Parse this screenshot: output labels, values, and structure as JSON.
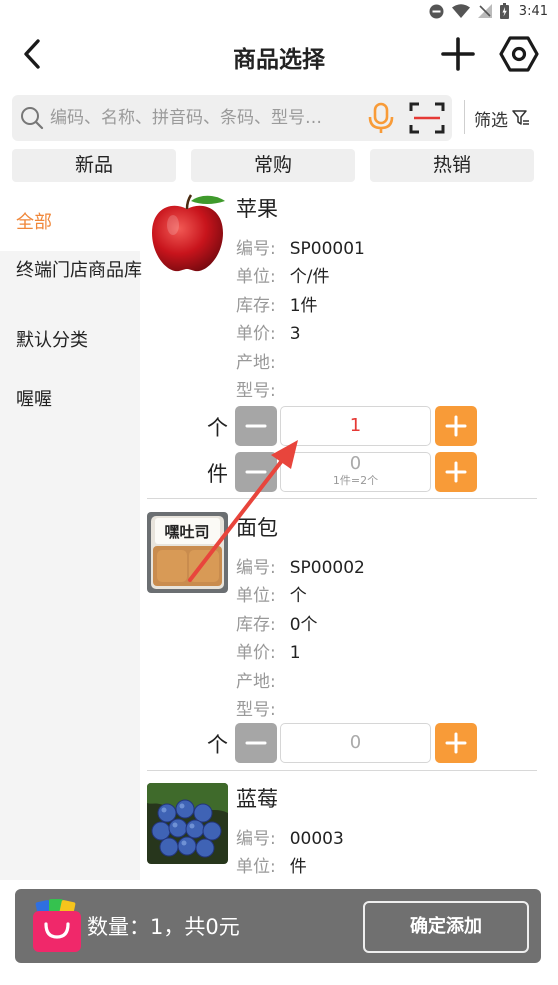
{
  "status": {
    "time": "3:41"
  },
  "header": {
    "title": "商品选择"
  },
  "search": {
    "placeholder": "编码、名称、拼音码、条码、型号…",
    "filter_label": "筛选"
  },
  "tabs": [
    {
      "label": "新品"
    },
    {
      "label": "常购"
    },
    {
      "label": "热销"
    }
  ],
  "sidebar": {
    "items": [
      {
        "label": "全部",
        "active": true
      },
      {
        "label": "终端门店商品库"
      },
      {
        "label": "默认分类"
      },
      {
        "label": "喔喔"
      }
    ]
  },
  "labels": {
    "code": "编号:",
    "unit": "单位:",
    "stock": "库存:",
    "price": "单价:",
    "origin": "产地:",
    "model": "型号:"
  },
  "products": [
    {
      "name": "苹果",
      "image": "apple",
      "code": "SP00001",
      "unit": "个/件",
      "stock": "1件",
      "price": "3",
      "origin": "",
      "model": "",
      "qty_rows": [
        {
          "unit": "个",
          "value": "1",
          "hint": ""
        },
        {
          "unit": "件",
          "value": "0",
          "hint": "1件=2个"
        }
      ]
    },
    {
      "name": "面包",
      "image": "bread",
      "image_text": "嘿吐司",
      "code": "SP00002",
      "unit": "个",
      "stock": "0个",
      "price": "1",
      "origin": "",
      "model": "",
      "qty_rows": [
        {
          "unit": "个",
          "value": "0",
          "hint": ""
        }
      ]
    },
    {
      "name": "蓝莓",
      "image": "blueberry",
      "code": "00003",
      "unit": "件"
    }
  ],
  "bottom": {
    "summary": "数量：1，共0元",
    "confirm_label": "确定添加"
  },
  "colors": {
    "accent": "#f89b38",
    "active_text": "#f0873a",
    "qty_active": "#e53935",
    "arrow": "#e8453c",
    "bottom_bar": "#707070"
  }
}
